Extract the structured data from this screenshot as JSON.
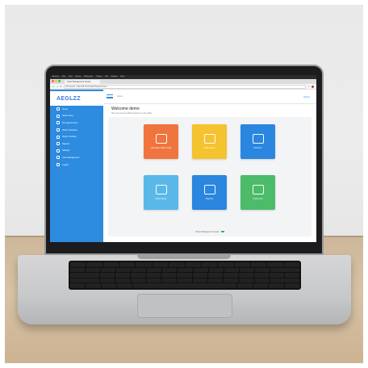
{
  "browser": {
    "menu_items": [
      "Browser",
      "Edit",
      "View",
      "History",
      "Bookmarks",
      "People",
      "Tab",
      "Window",
      "Help"
    ],
    "tab_title": "Visitor Management System",
    "url": "Not Secure | 192.168.10.10/VisitorSystem/home"
  },
  "app": {
    "brand": "AEGLZZ",
    "breadcrumb": "Home",
    "user_label": "Admin",
    "welcome_title": "Welcome demo",
    "welcome_subtitle": "Here you can see what's going on in your office.",
    "sidebar": {
      "items": [
        {
          "label": "Home",
          "icon": "home-icon"
        },
        {
          "label": "Visitor Entry",
          "icon": "user-plus-icon"
        },
        {
          "label": "Pre-Appointment",
          "icon": "calendar-icon"
        },
        {
          "label": "Visitor Checkout",
          "icon": "logout-icon"
        },
        {
          "label": "Visitor Tracking",
          "icon": "location-icon"
        },
        {
          "label": "Reports",
          "icon": "chart-icon"
        },
        {
          "label": "Settings",
          "icon": "gear-icon"
        },
        {
          "label": "User Management",
          "icon": "users-icon"
        },
        {
          "label": "Logout",
          "icon": "power-icon"
        }
      ]
    },
    "tiles": [
      {
        "label": "Generate Visitor Card",
        "color": "#f0743e",
        "icon": "card-icon"
      },
      {
        "label": "Visitor Entry",
        "color": "#f5c230",
        "icon": "door-icon"
      },
      {
        "label": "Check-In",
        "color": "#2a86df",
        "icon": "bed-icon"
      },
      {
        "label": "Visitor Entry",
        "color": "#5ab8e8",
        "icon": "building-icon"
      },
      {
        "label": "Reports",
        "color": "#2a86df",
        "icon": "chart-icon"
      },
      {
        "label": "Check-Out",
        "color": "#4cbb6a",
        "icon": "monitor-icon"
      }
    ],
    "footer": "Visitor Management System"
  },
  "colors": {
    "sidebar": "#2d8be0",
    "accent": "#2d8be0"
  }
}
